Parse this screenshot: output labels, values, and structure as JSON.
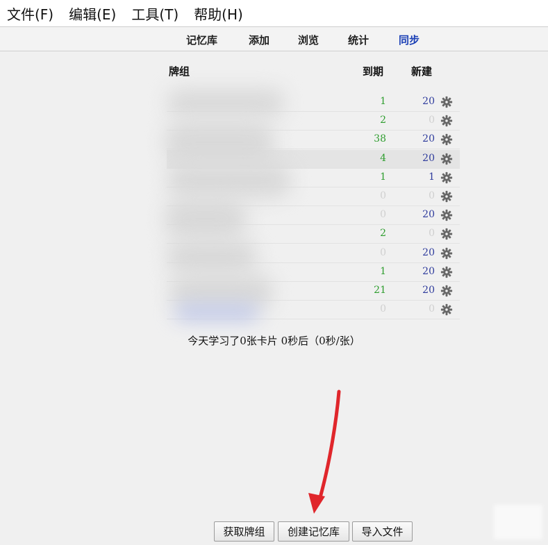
{
  "menu": [
    "文件(F)",
    "编辑(E)",
    "工具(T)",
    "帮助(H)"
  ],
  "toolbar": {
    "items": [
      {
        "label": "记忆库",
        "active": false
      },
      {
        "label": "添加",
        "active": false
      },
      {
        "label": "浏览",
        "active": false
      },
      {
        "label": "统计",
        "active": false
      },
      {
        "label": "同步",
        "active": true
      }
    ]
  },
  "deck_table": {
    "headers": {
      "deck": "牌组",
      "due": "到期",
      "new": "新建"
    },
    "rows": [
      {
        "due": "1",
        "new": "20",
        "due_state": "green",
        "new_state": "blue"
      },
      {
        "due": "2",
        "new": "0",
        "due_state": "green",
        "new_state": "grey"
      },
      {
        "due": "38",
        "new": "20",
        "due_state": "green",
        "new_state": "blue"
      },
      {
        "due": "4",
        "new": "20",
        "due_state": "green",
        "new_state": "blue",
        "highlight": true
      },
      {
        "due": "1",
        "new": "1",
        "due_state": "green",
        "new_state": "blue"
      },
      {
        "due": "0",
        "new": "0",
        "due_state": "grey",
        "new_state": "grey"
      },
      {
        "due": "0",
        "new": "20",
        "due_state": "grey",
        "new_state": "blue"
      },
      {
        "due": "2",
        "new": "0",
        "due_state": "green",
        "new_state": "grey"
      },
      {
        "due": "0",
        "new": "20",
        "due_state": "grey",
        "new_state": "blue"
      },
      {
        "due": "1",
        "new": "20",
        "due_state": "green",
        "new_state": "blue"
      },
      {
        "due": "21",
        "new": "20",
        "due_state": "green",
        "new_state": "blue"
      },
      {
        "due": "0",
        "new": "0",
        "due_state": "grey",
        "new_state": "grey"
      }
    ]
  },
  "summary": "今天学习了0张卡片 0秒后（0秒/张）",
  "buttons": {
    "get_decks": "获取牌组",
    "create_deck": "创建记忆库",
    "import_file": "导入文件"
  },
  "colors": {
    "green": "#2e9d2e",
    "blue": "#2d3a9c",
    "grey": "#cfcfcf",
    "active_link": "#1a3fb5",
    "arrow": "#e0262b"
  }
}
